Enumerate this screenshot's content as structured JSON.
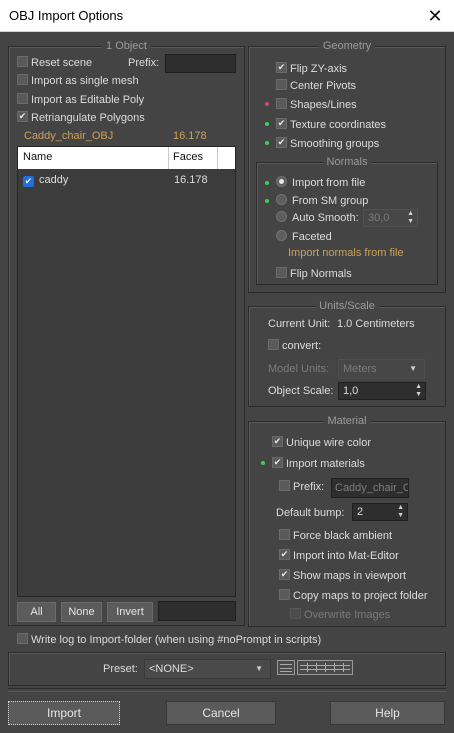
{
  "window": {
    "title": "OBJ Import Options"
  },
  "objects_group": {
    "title": "1 Object",
    "reset_scene": "Reset scene",
    "prefix_label": "Prefix:",
    "prefix_value": "",
    "import_single_mesh": "Import as single mesh",
    "import_editable_poly": "Import as Editable Poly",
    "retriangulate": "Retriangulate Polygons",
    "file_name": "Caddy_chair_OBJ",
    "file_faces": "16.178",
    "columns": {
      "name": "Name",
      "faces": "Faces"
    },
    "rows": [
      {
        "name": "caddy",
        "faces": "16.178",
        "checked": true
      }
    ],
    "buttons": {
      "all": "All",
      "none": "None",
      "invert": "Invert"
    },
    "filter_value": ""
  },
  "geometry": {
    "title": "Geometry",
    "flip_zy": "Flip ZY-axis",
    "center_pivots": "Center Pivots",
    "shapes_lines": "Shapes/Lines",
    "texture_coordinates": "Texture coordinates",
    "smoothing_groups": "Smoothing groups",
    "normals": {
      "title": "Normals",
      "import_from_file": "Import from file",
      "from_sm_group": "From SM group",
      "auto_smooth": "Auto Smooth:",
      "auto_smooth_value": "30,0",
      "faceted": "Faceted",
      "hint": "Import normals from file",
      "flip_normals": "Flip Normals"
    }
  },
  "units": {
    "title": "Units/Scale",
    "current_unit_label": "Current Unit:",
    "current_unit_value": "1.0 Centimeters",
    "convert": "convert:",
    "model_units_label": "Model Units:",
    "model_units_value": "Meters",
    "object_scale_label": "Object Scale:",
    "object_scale_value": "1,0"
  },
  "material": {
    "title": "Material",
    "unique_wire_color": "Unique wire color",
    "import_materials": "Import materials",
    "prefix_label": "Prefix:",
    "prefix_value": "Caddy_chair_O",
    "default_bump_label": "Default bump:",
    "default_bump_value": "2",
    "force_black_ambient": "Force black ambient",
    "import_mat_editor": "Import into Mat-Editor",
    "show_maps": "Show maps in viewport",
    "copy_maps": "Copy maps to project folder",
    "overwrite_images": "Overwrite Images"
  },
  "log": {
    "write_log": "Write log to Import-folder (when using #noPrompt in scripts)"
  },
  "preset": {
    "label": "Preset:",
    "value": "<NONE>"
  },
  "footer": {
    "import": "Import",
    "cancel": "Cancel",
    "help": "Help"
  },
  "colors": {
    "accent_tan": "#c9a25a",
    "status_green": "#3fcc52",
    "status_red": "#d84a6a",
    "check_blue": "#1e6fd9"
  }
}
